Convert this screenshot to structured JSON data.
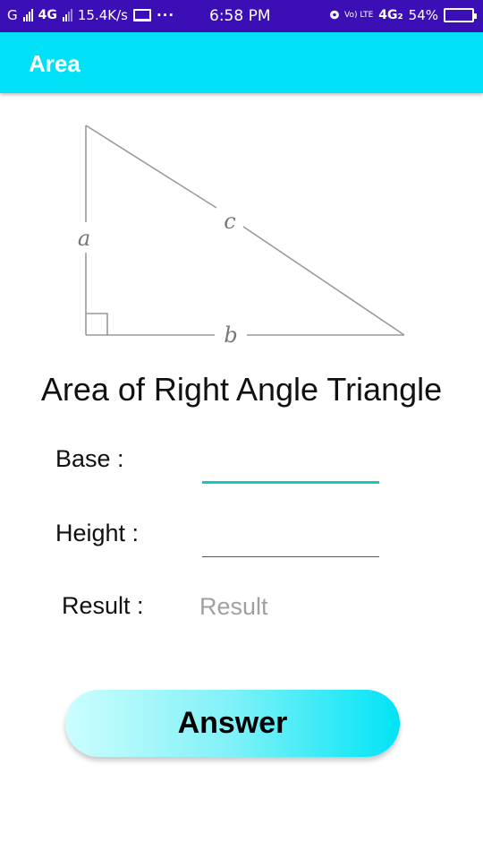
{
  "status_bar": {
    "carrier": "G",
    "network_left": "4G",
    "speed": "15.4K/s",
    "more": "···",
    "time": "6:58 PM",
    "volte": "Vo) LTE",
    "network_right": "4G₂",
    "battery": "54%"
  },
  "app_bar": {
    "title": "Area"
  },
  "diagram": {
    "label_a": "a",
    "label_b": "b",
    "label_c": "c"
  },
  "main": {
    "heading": "Area of Right Angle Triangle",
    "base_label": "Base :",
    "base_value": "",
    "height_label": "Height :",
    "height_value": "",
    "result_label": "Result :",
    "result_placeholder": "Result",
    "answer_label": "Answer"
  },
  "colors": {
    "status_bar": "#3b0fb5",
    "app_bar": "#00e1f7",
    "focus_underline": "#14c7c0",
    "button_gradient_start": "#ccfdfd",
    "button_gradient_end": "#00e4f6"
  }
}
